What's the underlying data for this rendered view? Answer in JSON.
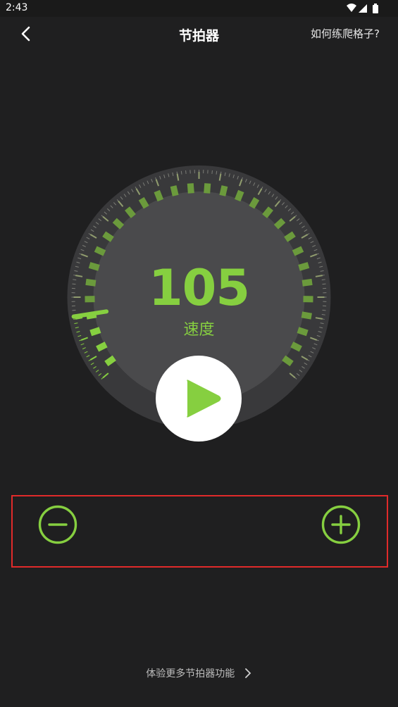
{
  "status_bar": {
    "time": "2:43"
  },
  "nav": {
    "title": "节拍器",
    "help_link": "如何练爬格子?"
  },
  "metronome": {
    "bpm": "105",
    "tempo_label": "速度",
    "tempo_fraction": 0.12
  },
  "footer": {
    "more_features": "体验更多节拍器功能"
  },
  "colors": {
    "accent": "#86cf40",
    "background": "#1f1f20",
    "dial_face": "#4a4a4c",
    "highlight_box": "#e02a2a"
  },
  "icons": {
    "back": "chevron-left-icon",
    "play": "play-icon",
    "minus": "minus-circle-icon",
    "plus": "plus-circle-icon",
    "more": "chevron-right-icon"
  }
}
